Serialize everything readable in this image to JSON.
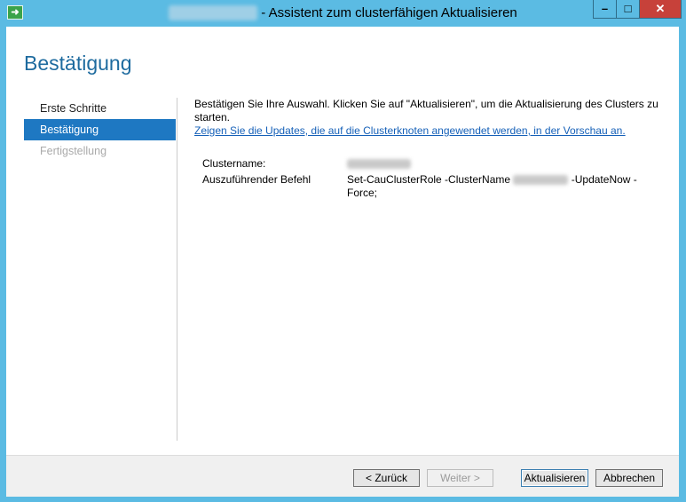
{
  "window": {
    "title": "- Assistent zum clusterfähigen Aktualisieren",
    "controls": {
      "minimize": "–",
      "maximize": "□",
      "close": "✕"
    }
  },
  "page": {
    "title": "Bestätigung"
  },
  "nav": {
    "items": [
      {
        "label": "Erste Schritte",
        "state": "normal"
      },
      {
        "label": "Bestätigung",
        "state": "active"
      },
      {
        "label": "Fertigstellung",
        "state": "disabled"
      }
    ]
  },
  "content": {
    "description": "Bestätigen Sie Ihre Auswahl. Klicken Sie auf \"Aktualisieren\", um die Aktualisierung des Clusters zu starten.",
    "preview_link": "Zeigen Sie die Updates, die auf die Clusterknoten angewendet werden, in der Vorschau an.",
    "details": {
      "cluster_label": "Clustername:",
      "command_label": "Auszuführender Befehl",
      "command_prefix": "Set-CauClusterRole -ClusterName",
      "command_suffix": "-UpdateNow -Force;"
    }
  },
  "footer": {
    "back": "< Zurück",
    "next": "Weiter >",
    "update": "Aktualisieren",
    "cancel": "Abbrechen"
  },
  "colors": {
    "frame": "#5bbbe3",
    "accent": "#1e78c2",
    "title": "#1e6b9f",
    "link": "#1560b8"
  }
}
